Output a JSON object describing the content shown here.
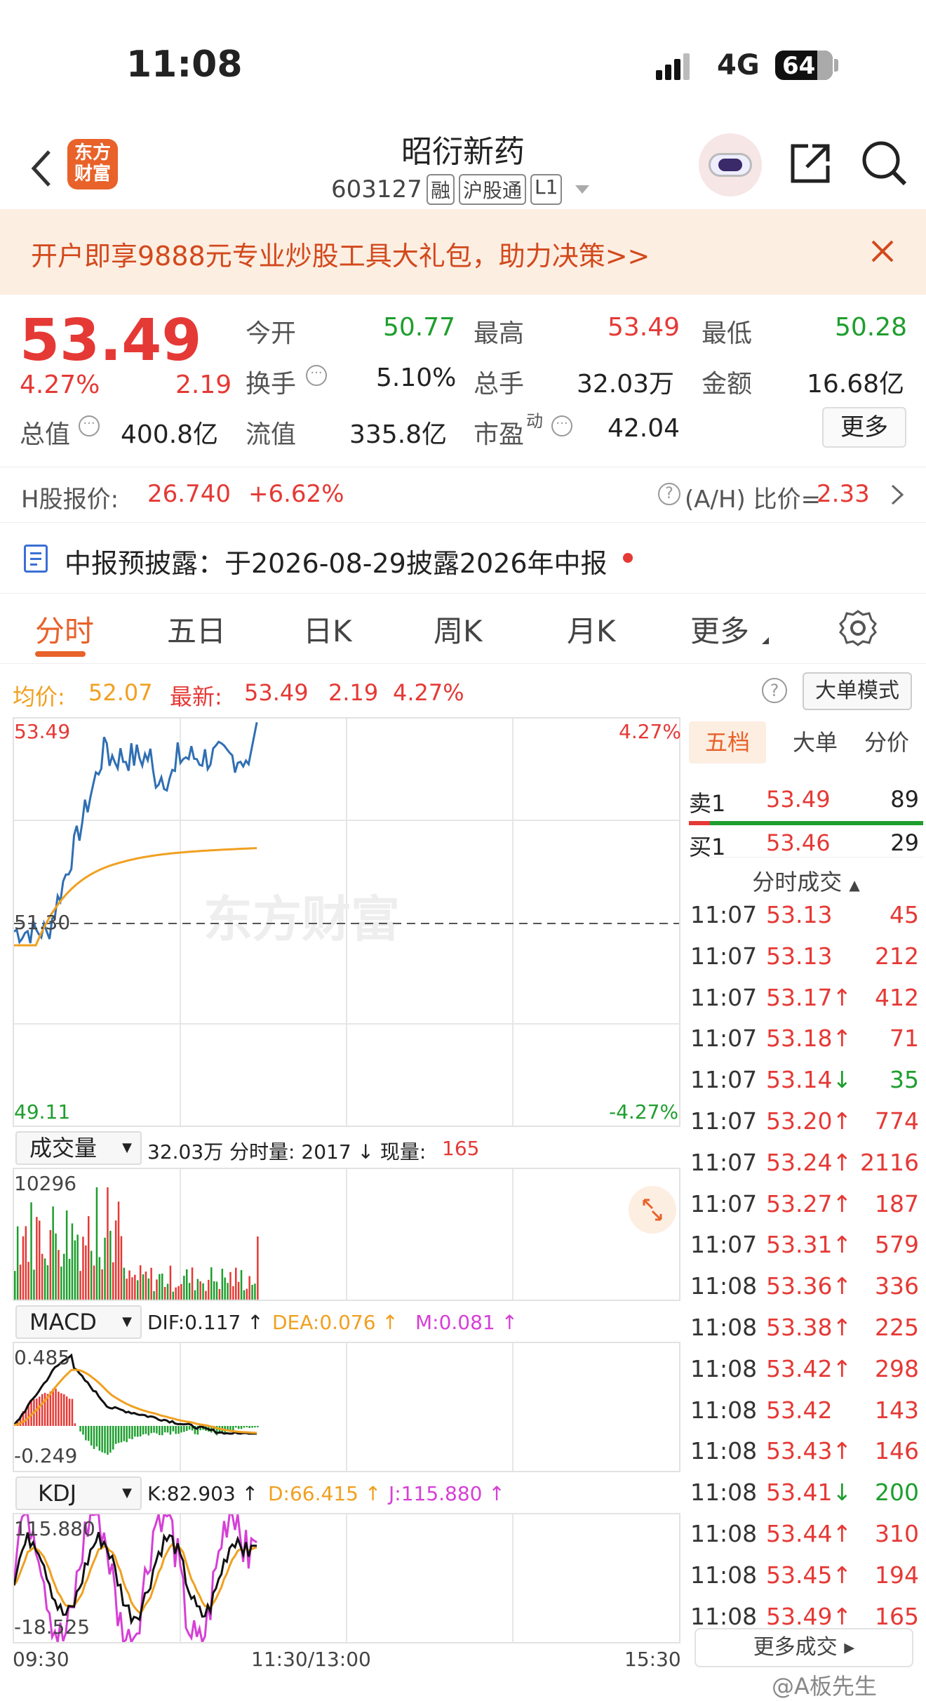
{
  "status": {
    "time": "11:08",
    "network": "4G",
    "battery": "64"
  },
  "nav": {
    "logo_top": "东方",
    "logo_bottom": "财富",
    "title": "昭衍新药",
    "code": "603127",
    "tags": [
      "融",
      "沪股通",
      "L1"
    ]
  },
  "banner": {
    "text": "开户即享9888元专业炒股工具大礼包，助力决策>>"
  },
  "quote": {
    "price": "53.49",
    "pct": "4.27%",
    "chg": "2.19",
    "items": [
      {
        "label": "今开",
        "value": "50.77",
        "color": "#1e9e2e"
      },
      {
        "label": "最高",
        "value": "53.49",
        "color": "#e53935"
      },
      {
        "label": "最低",
        "value": "50.28",
        "color": "#1e9e2e"
      },
      {
        "label": "换手",
        "value": "5.10%",
        "color": "#222"
      },
      {
        "label": "总手",
        "value": "32.03万",
        "color": "#222"
      },
      {
        "label": "金额",
        "value": "16.68亿",
        "color": "#222"
      },
      {
        "label": "总值",
        "value": "400.8亿",
        "color": "#222"
      },
      {
        "label": "流值",
        "value": "335.8亿",
        "color": "#222"
      },
      {
        "label": "市盈",
        "value": "42.04",
        "color": "#222"
      }
    ],
    "pe_sup": "动",
    "more": "更多"
  },
  "hshare": {
    "label": "H股报价:",
    "price": "26.740",
    "pct": "+6.62%",
    "ratio_label": "(A/H) 比价=",
    "ratio": "2.33"
  },
  "notice": {
    "text": "中报预披露：于2026-08-29披露2026年中报"
  },
  "tabs": [
    "分时",
    "五日",
    "日K",
    "周K",
    "月K",
    "更多"
  ],
  "chart_info": {
    "avg_label": "均价:",
    "avg": "52.07",
    "latest_label": "最新:",
    "latest": "53.49",
    "chg": "2.19",
    "pct": "4.27%",
    "mode": "大单模式"
  },
  "chart_axis": {
    "top": "53.49",
    "mid": "51.30",
    "bot": "49.11",
    "top_pct": "4.27%",
    "bot_pct": "-4.27%",
    "watermark": "东方财富"
  },
  "volume": {
    "select": "成交量",
    "text": "32.03万 分时量: 2017 ↓ 现量:",
    "now": "165",
    "max": "10296"
  },
  "macd": {
    "select": "MACD",
    "dif": "DIF:0.117 ↑",
    "dea": "DEA:0.076 ↑",
    "m": "M:0.081 ↑",
    "max": "0.485",
    "min": "-0.249"
  },
  "kdj": {
    "select": "KDJ",
    "k": "K:82.903 ↑",
    "d": "D:66.415 ↑",
    "j": "J:115.880 ↑",
    "max": "115.880",
    "min": "-18.525"
  },
  "time_axis": {
    "start": "09:30",
    "mid": "11:30/13:00",
    "end": "15:30"
  },
  "side": {
    "tabs": [
      "五档",
      "大单",
      "分价"
    ],
    "sell": {
      "label": "卖1",
      "price": "53.49",
      "vol": "89"
    },
    "buy": {
      "label": "买1",
      "price": "53.46",
      "vol": "29"
    },
    "trade_title": "分时成交",
    "more": "更多成交",
    "trades": [
      {
        "t": "11:07",
        "p": "53.13",
        "a": "",
        "v": "45",
        "vc": "red"
      },
      {
        "t": "11:07",
        "p": "53.13",
        "a": "",
        "v": "212",
        "vc": "red"
      },
      {
        "t": "11:07",
        "p": "53.17",
        "a": "↑",
        "v": "412",
        "vc": "red"
      },
      {
        "t": "11:07",
        "p": "53.18",
        "a": "↑",
        "v": "71",
        "vc": "red"
      },
      {
        "t": "11:07",
        "p": "53.14",
        "a": "↓",
        "v": "35",
        "vc": "green"
      },
      {
        "t": "11:07",
        "p": "53.20",
        "a": "↑",
        "v": "774",
        "vc": "red"
      },
      {
        "t": "11:07",
        "p": "53.24",
        "a": "↑",
        "v": "2116",
        "vc": "red"
      },
      {
        "t": "11:07",
        "p": "53.27",
        "a": "↑",
        "v": "187",
        "vc": "red"
      },
      {
        "t": "11:07",
        "p": "53.31",
        "a": "↑",
        "v": "579",
        "vc": "red"
      },
      {
        "t": "11:08",
        "p": "53.36",
        "a": "↑",
        "v": "336",
        "vc": "red"
      },
      {
        "t": "11:08",
        "p": "53.38",
        "a": "↑",
        "v": "225",
        "vc": "red"
      },
      {
        "t": "11:08",
        "p": "53.42",
        "a": "↑",
        "v": "298",
        "vc": "red"
      },
      {
        "t": "11:08",
        "p": "53.42",
        "a": "",
        "v": "143",
        "vc": "red"
      },
      {
        "t": "11:08",
        "p": "53.43",
        "a": "↑",
        "v": "146",
        "vc": "red"
      },
      {
        "t": "11:08",
        "p": "53.41",
        "a": "↓",
        "v": "200",
        "vc": "green"
      },
      {
        "t": "11:08",
        "p": "53.44",
        "a": "↑",
        "v": "310",
        "vc": "red"
      },
      {
        "t": "11:08",
        "p": "53.45",
        "a": "↑",
        "v": "194",
        "vc": "red"
      },
      {
        "t": "11:08",
        "p": "53.49",
        "a": "↑",
        "v": "165",
        "vc": "red"
      }
    ]
  },
  "footer": {
    "watermark": "@A板先生"
  },
  "colors": {
    "up": "#e53935",
    "down": "#1e9e2e",
    "avg": "#f0a020",
    "price": "#2f6fb3",
    "accent": "#e8622a"
  }
}
